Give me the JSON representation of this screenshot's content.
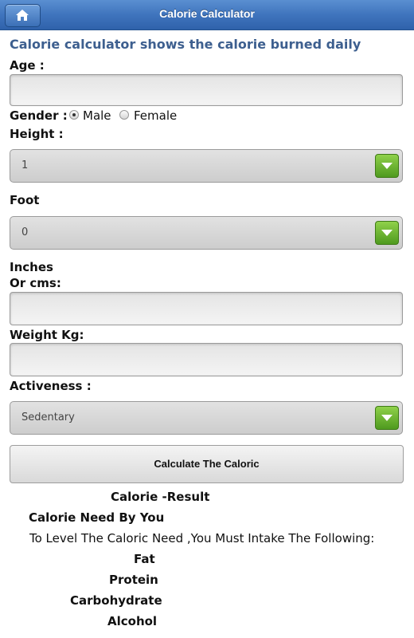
{
  "header": {
    "title": "Calorie Calculator",
    "home_icon": "home-icon"
  },
  "intro": "Calorie calculator shows the calorie burned daily",
  "form": {
    "age_label": "Age :",
    "age_value": "",
    "gender_label": "Gender :",
    "gender_options": [
      "Male",
      "Female"
    ],
    "gender_selected": "Male",
    "height_label": "Height :",
    "height_value": "1",
    "foot_label": "Foot",
    "foot_value": "0",
    "inches_label": "Inches",
    "cms_label": "Or cms:",
    "cms_value": "",
    "weight_label": "Weight Kg:",
    "weight_value": "",
    "activeness_label": "Activeness :",
    "activeness_value": "Sedentary",
    "calculate_label": "Calculate The Caloric"
  },
  "result": {
    "title": "Calorie -Result",
    "need_label": "Calorie Need By You",
    "intake_text": "To Level The Caloric Need ,You Must Intake The Following:",
    "fat_label": "Fat",
    "protein_label": "Protein",
    "carbohydrate_label": "Carbohydrate",
    "alcohol_label": "Alcohol"
  },
  "colors": {
    "header": "#3f74bd",
    "intro_text": "#3d5f8f",
    "dropdown_arrow": "#5fa82a"
  }
}
